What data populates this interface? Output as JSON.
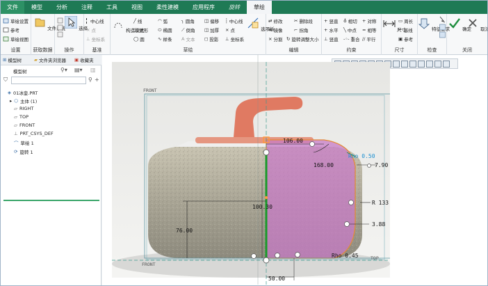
{
  "tabs": [
    {
      "label": "文件"
    },
    {
      "label": "模型"
    },
    {
      "label": "分析"
    },
    {
      "label": "注释"
    },
    {
      "label": "工具"
    },
    {
      "label": "视图"
    },
    {
      "label": "柔性建模"
    },
    {
      "label": "应用程序"
    },
    {
      "label": "旋转"
    },
    {
      "label": "草绘"
    }
  ],
  "ribbon": {
    "setup": {
      "items": [
        "草绘设置",
        "参考",
        "草绘视图"
      ],
      "group": "设置"
    },
    "getdata": {
      "file_system": "文件系统",
      "group": "获取数据"
    },
    "operations": {
      "select": "选择",
      "group": "操作"
    },
    "datum": {
      "items": [
        "中心线",
        "点",
        "坐标系"
      ],
      "group": "基准"
    },
    "sketch": {
      "construction_mode": "构造模式",
      "items": [
        "线",
        "弧",
        "圆角",
        "偏移",
        "中心线",
        "矩形",
        "椭圆",
        "倒角",
        "加厚",
        "点",
        "圆",
        "样条",
        "文本",
        "投影",
        "坐标系"
      ],
      "palette": "选项板",
      "group": "草绘"
    },
    "edit": {
      "items": [
        "修改",
        "删除段",
        "镜像",
        "拐角",
        "分割",
        "旋转调整大小"
      ],
      "group": "编辑"
    },
    "constrain": {
      "items": [
        "竖直",
        "相切",
        "对称",
        "水平",
        "中点",
        "相等",
        "重合",
        "平行"
      ],
      "group": "约束"
    },
    "dimension": {
      "label": "尺寸",
      "items": [
        "周长",
        "基线",
        "参考"
      ],
      "group": "尺寸"
    },
    "inspect": {
      "feature_req": "特征要求",
      "group": "检查"
    },
    "close": {
      "ok": "确定",
      "cancel": "取消",
      "group": "关闭"
    }
  },
  "tree": {
    "tabs": [
      "模型树",
      "文件夹浏览器",
      "收藏夹"
    ],
    "header": "模型树",
    "nodes": [
      "01冰壶.PRT",
      "主体 (1)",
      "RIGHT",
      "TOP",
      "FRONT",
      "PRT_CSYS_DEF",
      "草绘 1"
    ],
    "feature": "旋转 1"
  },
  "graphics": {
    "labels": {
      "front_top": "FRONT",
      "front_bottom": "FRONT",
      "top_plane": "TOP"
    },
    "dims": {
      "d1": "106.00",
      "d2": "168.00",
      "d3": "Rho 0.50",
      "d4": "7.90",
      "d5": "R 133.80",
      "d6": "3.88",
      "d7": "76.00",
      "d8": "100.30",
      "d9": "Rho 0.45",
      "d10": "50.00"
    }
  },
  "colors": {
    "ribbon_green": "#1f7a55",
    "sketch_fill": "#c77bc6",
    "sketch_outline": "#e38a3a",
    "centerline": "#1a9a2a",
    "highlight": "#ff9a3a"
  }
}
